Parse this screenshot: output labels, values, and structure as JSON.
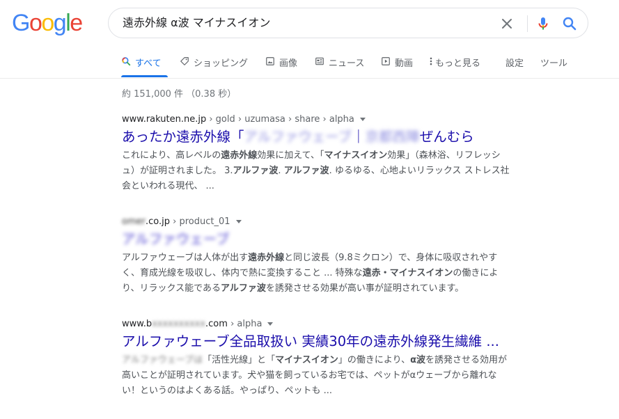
{
  "logo": {
    "letters": [
      "G",
      "o",
      "o",
      "g",
      "l",
      "e"
    ],
    "colors": [
      "#4285f4",
      "#ea4335",
      "#fbbc05",
      "#4285f4",
      "#34a853",
      "#ea4335"
    ]
  },
  "search": {
    "query": "遠赤外線 α波 マイナスイオン"
  },
  "tabs": [
    {
      "label": "すべて",
      "icon": "search-icon",
      "active": true
    },
    {
      "label": "ショッピング",
      "icon": "tag-icon"
    },
    {
      "label": "画像",
      "icon": "image-icon"
    },
    {
      "label": "ニュース",
      "icon": "news-icon"
    },
    {
      "label": "動画",
      "icon": "video-icon"
    },
    {
      "label": "もっと見る",
      "icon": "more-vert-icon"
    },
    {
      "label": "設定"
    },
    {
      "label": "ツール"
    }
  ],
  "result_stats": "約 151,000 件 （0.38 秒）",
  "results": [
    {
      "domain": "www.rakuten.ne.jp",
      "path": " › gold › uzumasa › share › alpha",
      "title_a": "あったか遠赤外線「",
      "title_blur1": "アルファウェーブ",
      "title_b": "｜",
      "title_blur2": "京都西陣",
      "title_c": "ぜんむら",
      "snippet1_a": "これにより、高レベルの",
      "snippet1_b1": "遠赤外線",
      "snippet1_c": "効果に加えて、「",
      "snippet1_b2": "マイナスイオン",
      "snippet1_d": "効果」（森林浴、リフレッシ",
      "snippet2_a": "ュ）が証明されました。 3.",
      "snippet2_b1": "アルファ波",
      "snippet2_c": ". ",
      "snippet2_b2": "アルファ波",
      "snippet2_d": ". ゆるゆる、心地よいリラックス ストレス社",
      "snippet3": "会といわれる現代、 ..."
    },
    {
      "domain_blur": "omer",
      "domain": ".co.jp",
      "path": " › product_01",
      "title_blur": "アルファウェーブ",
      "snippet1_a": "アルファウェーブは人体が出す",
      "snippet1_b": "遠赤外線",
      "snippet1_c": "と同じ波長（9.8ミクロン）で、身体に吸収されやす",
      "snippet2_a": "く、育成光線を吸収し、体内で熱に変換すること ... 特殊な",
      "snippet2_b": "遠赤・マイナスイオン",
      "snippet2_c": "の働きによ",
      "snippet3_a": "り、リラックス能である",
      "snippet3_b": "アルファ波",
      "snippet3_c": "を誘発させる効果が高い事が証明されています。"
    },
    {
      "domain_a": "www.b",
      "domain_blur": "xxxxxxxxxx",
      "domain_b": ".com",
      "path": " › alpha",
      "title": "アルファウェーブ全品取扱い 実績30年の遠赤外線発生繊維 ...",
      "snippet1_blur": "アルファウェーブは",
      "snippet1_a": "「活性光線」と「",
      "snippet1_b1": "マイナスイオン",
      "snippet1_c": "」の働きにより、",
      "snippet1_b2": "α波",
      "snippet1_d": "を誘発させる効用が",
      "snippet2": "高いことが証明されています。犬や猫を飼っているお宅では、ペットがαウェーブから離れな",
      "snippet3": "い！というのはよくある話。やっぱり、ペットも ..."
    }
  ]
}
